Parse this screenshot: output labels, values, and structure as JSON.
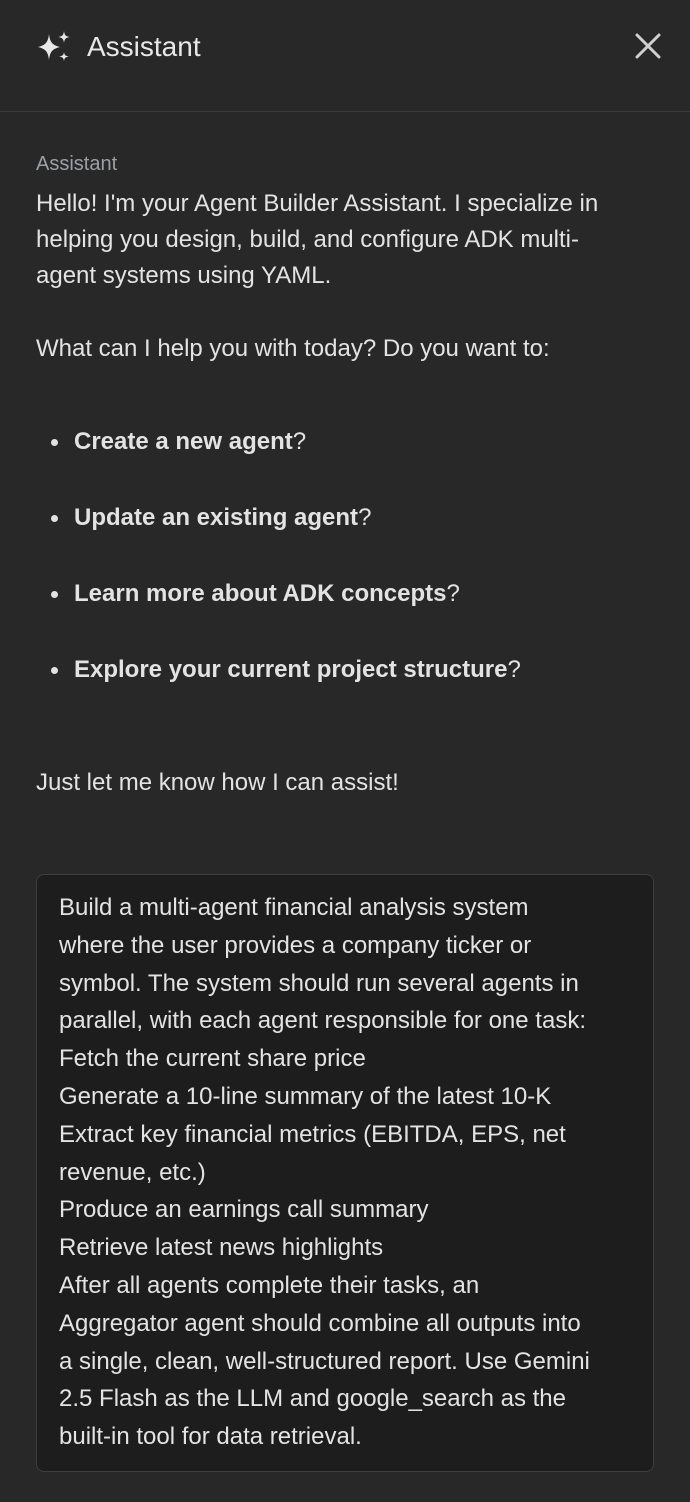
{
  "header": {
    "title": "Assistant",
    "icon": "sparkle-icon",
    "close_icon": "close-icon"
  },
  "assistant_message": {
    "sender": "Assistant",
    "intro_lines": [
      "Hello! I'm your Agent Builder Assistant. I specialize in",
      "helping you design, build, and configure ADK multi-",
      "agent systems using YAML."
    ],
    "question": "What can I help you with today? Do you want to:",
    "options": [
      {
        "bold": "Create a new agent",
        "suffix": "?"
      },
      {
        "bold": "Update an existing agent",
        "suffix": "?"
      },
      {
        "bold": "Learn more about ADK concepts",
        "suffix": "?"
      },
      {
        "bold": "Explore your current project structure",
        "suffix": "?"
      }
    ],
    "closing": "Just let me know how I can assist!"
  },
  "user_message": {
    "lines": [
      "Build a multi-agent financial analysis system",
      "where the user provides a company ticker or",
      "symbol. The system should run several agents in",
      "parallel, with each agent responsible for one task:",
      "Fetch the current share price",
      "Generate a 10-line summary of the latest 10-K",
      "Extract key financial metrics (EBITDA, EPS, net",
      "revenue, etc.)",
      "Produce an earnings call summary",
      "Retrieve latest news highlights",
      "After all agents complete their tasks, an",
      "Aggregator agent should combine all outputs into",
      "a single, clean, well-structured report. Use Gemini",
      "2.5 Flash as the LLM and google_search as the",
      "built-in tool for data retrieval."
    ]
  }
}
